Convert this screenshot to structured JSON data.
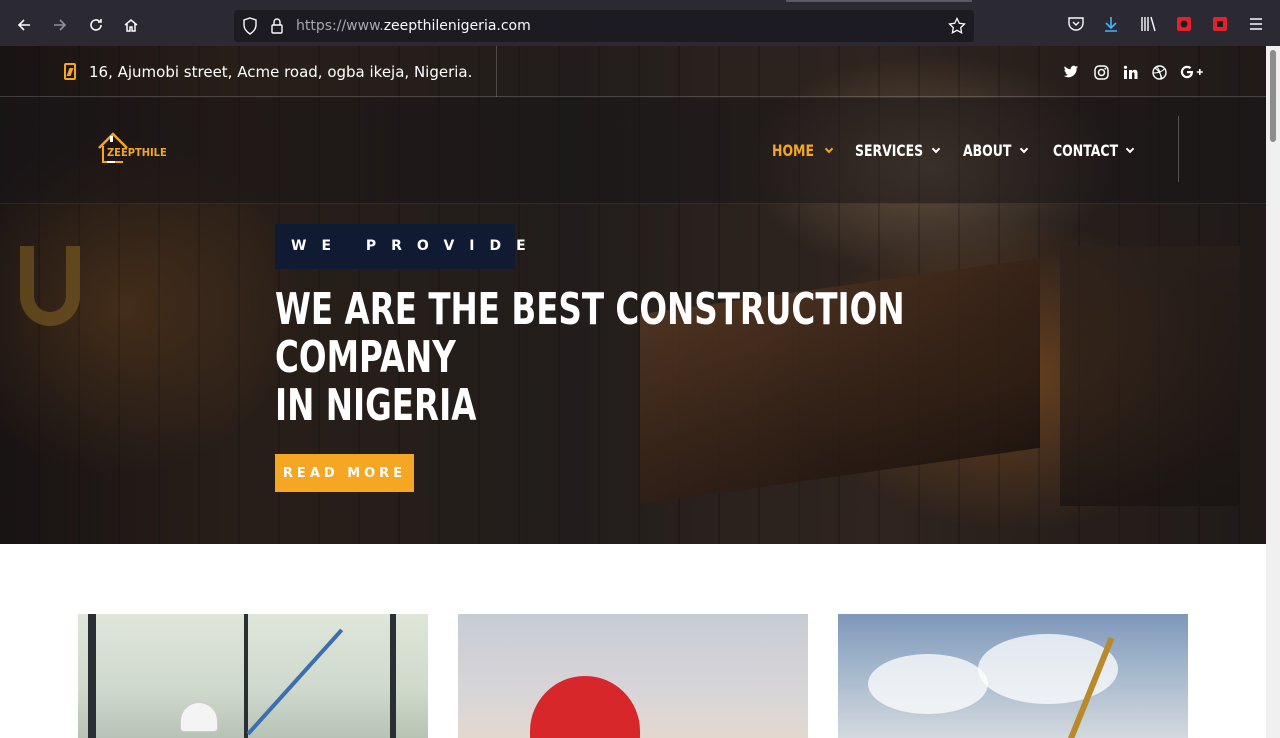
{
  "browser": {
    "url_prefix": "https://www.",
    "url_domain": "zeepthilenigeria.com",
    "nav_icons": [
      "back-arrow-icon",
      "forward-arrow-icon",
      "reload-icon",
      "home-icon"
    ],
    "toolbar_icons": [
      "pocket-icon",
      "download-icon",
      "library-icon",
      "extension-red-icon",
      "extension-red2-icon",
      "menu-icon"
    ]
  },
  "topbar": {
    "address": "16, Ajumobi street, Acme road, ogba ikeja, Nigeria.",
    "social": [
      {
        "name": "twitter-icon",
        "glyph": "🐦"
      },
      {
        "name": "instagram-icon",
        "glyph": "◎"
      },
      {
        "name": "linkedin-icon",
        "glyph": "in"
      },
      {
        "name": "dribbble-icon",
        "glyph": "⊛"
      },
      {
        "name": "google-plus-icon",
        "glyph": "G+"
      }
    ]
  },
  "header": {
    "logo_text": "ZEEPTHILE",
    "nav": [
      {
        "label": "HOME",
        "active": true
      },
      {
        "label": "SERVICES",
        "active": false
      },
      {
        "label": "ABOUT",
        "active": false
      },
      {
        "label": "CONTACT",
        "active": false
      }
    ]
  },
  "hero": {
    "kicker": "WE PROVIDE",
    "headline_line1": "WE ARE THE BEST CONSTRUCTION",
    "headline_line2": "COMPANY",
    "headline_line3": "IN NIGERIA",
    "cta": "READ MORE"
  },
  "colors": {
    "accent": "#f5a623",
    "kicker_bg": "#101a33",
    "browser_bg": "#2b2a33"
  }
}
